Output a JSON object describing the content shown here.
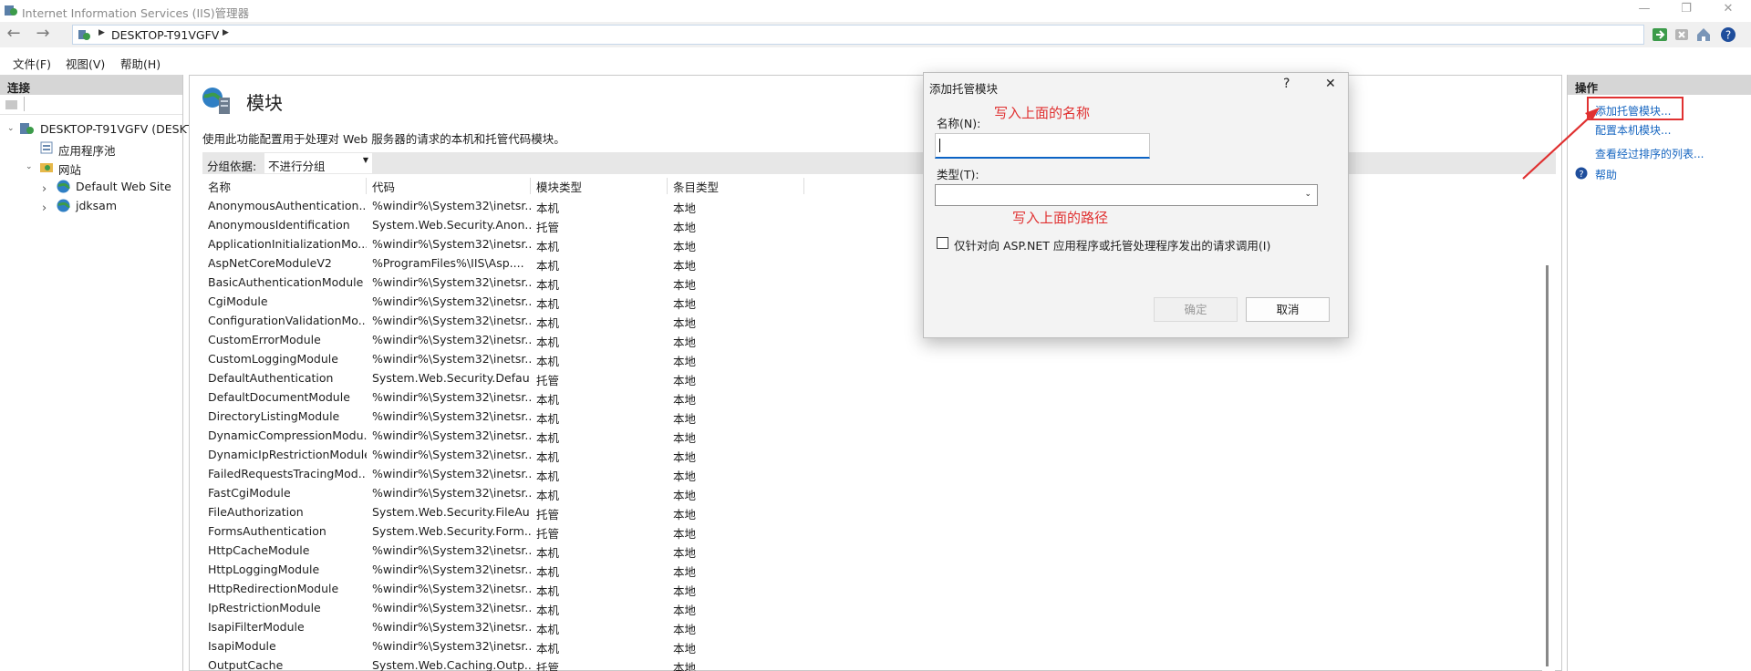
{
  "window": {
    "title": "Internet Information Services (IIS)管理器",
    "controls": [
      "—",
      "❐",
      "✕"
    ]
  },
  "address": {
    "server": "DESKTOP-T91VGFV",
    "back": "←",
    "forward": "→"
  },
  "menu": [
    "文件(F)",
    "视图(V)",
    "帮助(H)"
  ],
  "connections": {
    "title": "连接",
    "tree": [
      {
        "label": "DESKTOP-T91VGFV (DESKT",
        "expander": "⌄"
      },
      {
        "label": "应用程序池",
        "expander": ""
      },
      {
        "label": "网站",
        "expander": "⌄"
      },
      {
        "label": "Default Web Site",
        "expander": "›"
      },
      {
        "label": "jdksam",
        "expander": "›"
      }
    ]
  },
  "main": {
    "title": "模块",
    "description": "使用此功能配置用于处理对 Web 服务器的请求的本机和托管代码模块。",
    "group_by_label": "分组依据:",
    "group_by_value": "不进行分组",
    "columns": [
      "名称",
      "代码",
      "模块类型",
      "条目类型"
    ],
    "rows": [
      [
        "AnonymousAuthentication...",
        "%windir%\\System32\\inetsr...",
        "本机",
        "本地"
      ],
      [
        "AnonymousIdentification",
        "System.Web.Security.Anon...",
        "托管",
        "本地"
      ],
      [
        "ApplicationInitializationMo...",
        "%windir%\\System32\\inetsr...",
        "本机",
        "本地"
      ],
      [
        "AspNetCoreModuleV2",
        "%ProgramFiles%\\IIS\\Asp....",
        "本机",
        "本地"
      ],
      [
        "BasicAuthenticationModule",
        "%windir%\\System32\\inetsr...",
        "本机",
        "本地"
      ],
      [
        "CgiModule",
        "%windir%\\System32\\inetsr...",
        "本机",
        "本地"
      ],
      [
        "ConfigurationValidationMo...",
        "%windir%\\System32\\inetsr...",
        "本机",
        "本地"
      ],
      [
        "CustomErrorModule",
        "%windir%\\System32\\inetsr...",
        "本机",
        "本地"
      ],
      [
        "CustomLoggingModule",
        "%windir%\\System32\\inetsr...",
        "本机",
        "本地"
      ],
      [
        "DefaultAuthentication",
        "System.Web.Security.Defau...",
        "托管",
        "本地"
      ],
      [
        "DefaultDocumentModule",
        "%windir%\\System32\\inetsr...",
        "本机",
        "本地"
      ],
      [
        "DirectoryListingModule",
        "%windir%\\System32\\inetsr...",
        "本机",
        "本地"
      ],
      [
        "DynamicCompressionModu...",
        "%windir%\\System32\\inetsr...",
        "本机",
        "本地"
      ],
      [
        "DynamicIpRestrictionModule",
        "%windir%\\System32\\inetsr...",
        "本机",
        "本地"
      ],
      [
        "FailedRequestsTracingMod...",
        "%windir%\\System32\\inetsr...",
        "本机",
        "本地"
      ],
      [
        "FastCgiModule",
        "%windir%\\System32\\inetsr...",
        "本机",
        "本地"
      ],
      [
        "FileAuthorization",
        "System.Web.Security.FileAu...",
        "托管",
        "本地"
      ],
      [
        "FormsAuthentication",
        "System.Web.Security.Form...",
        "托管",
        "本地"
      ],
      [
        "HttpCacheModule",
        "%windir%\\System32\\inetsr...",
        "本机",
        "本地"
      ],
      [
        "HttpLoggingModule",
        "%windir%\\System32\\inetsr...",
        "本机",
        "本地"
      ],
      [
        "HttpRedirectionModule",
        "%windir%\\System32\\inetsr...",
        "本机",
        "本地"
      ],
      [
        "IpRestrictionModule",
        "%windir%\\System32\\inetsr...",
        "本机",
        "本地"
      ],
      [
        "IsapiFilterModule",
        "%windir%\\System32\\inetsr...",
        "本机",
        "本地"
      ],
      [
        "IsapiModule",
        "%windir%\\System32\\inetsr...",
        "本机",
        "本地"
      ],
      [
        "OutputCache",
        "System.Web.Caching.Outp...",
        "托管",
        "本地"
      ]
    ]
  },
  "actions": {
    "title": "操作",
    "items": [
      "添加托管模块...",
      "配置本机模块...",
      "查看经过排序的列表...",
      "帮助"
    ]
  },
  "dialog": {
    "title": "添加托管模块",
    "help": "?",
    "close": "✕",
    "name_label": "名称(N):",
    "name_value": "",
    "type_label": "类型(T):",
    "type_value": "",
    "checkbox_label": "仅针对向 ASP.NET 应用程序或托管处理程序发出的请求调用(I)",
    "ok": "确定",
    "cancel": "取消"
  },
  "annotations": {
    "name_hint": "写入上面的名称",
    "path_hint": "写入上面的路径",
    "color": "#e03131"
  }
}
